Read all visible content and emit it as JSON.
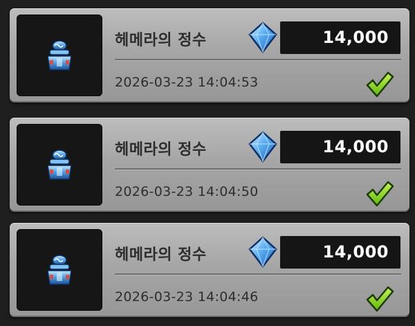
{
  "colors": {
    "card": "#a8a8a8",
    "price_box": "#151515",
    "check": "#8fdc1c",
    "gem": "#5aa8f0"
  },
  "purchases": [
    {
      "item_icon": "essence-jar-icon",
      "name": "헤메라의 정수",
      "currency_icon": "diamond-gem-icon",
      "price": "14,000",
      "timestamp": "2026-03-23 14:04:53",
      "status_icon": "check-icon"
    },
    {
      "item_icon": "essence-jar-icon",
      "name": "헤메라의 정수",
      "currency_icon": "diamond-gem-icon",
      "price": "14,000",
      "timestamp": "2026-03-23 14:04:50",
      "status_icon": "check-icon"
    },
    {
      "item_icon": "essence-jar-icon",
      "name": "헤메라의 정수",
      "currency_icon": "diamond-gem-icon",
      "price": "14,000",
      "timestamp": "2026-03-23 14:04:46",
      "status_icon": "check-icon"
    }
  ]
}
